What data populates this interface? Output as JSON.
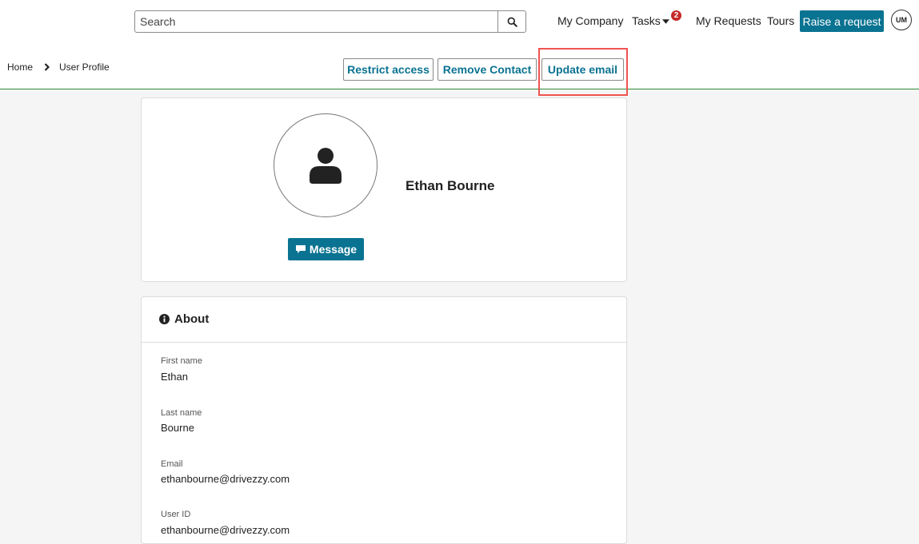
{
  "search": {
    "placeholder": "Search"
  },
  "nav": {
    "my_company": "My Company",
    "tasks": "Tasks",
    "tasks_badge": "2",
    "my_requests": "My Requests",
    "tours": "Tours",
    "raise_request": "Raise a request",
    "avatar_initials": "UM"
  },
  "breadcrumb": {
    "home": "Home",
    "current": "User Profile"
  },
  "actions": {
    "restrict": "Restrict access",
    "remove": "Remove Contact",
    "update_email": "Update email"
  },
  "profile": {
    "name": "Ethan Bourne",
    "message_label": "Message"
  },
  "about": {
    "title": "About",
    "fields": [
      {
        "label": "First name",
        "value": "Ethan"
      },
      {
        "label": "Last name",
        "value": "Bourne"
      },
      {
        "label": "Email",
        "value": "ethanbourne@drivezzy.com"
      },
      {
        "label": "User ID",
        "value": "ethanbourne@drivezzy.com"
      }
    ]
  },
  "colors": {
    "primary": "#0a7391",
    "divider_green": "#2e8b37",
    "badge_red": "#c62828",
    "highlight": "#ef5350"
  },
  "icons": [
    "search-icon",
    "caret-down-icon",
    "chevron-right-icon",
    "user-icon",
    "comment-icon",
    "info-icon"
  ]
}
